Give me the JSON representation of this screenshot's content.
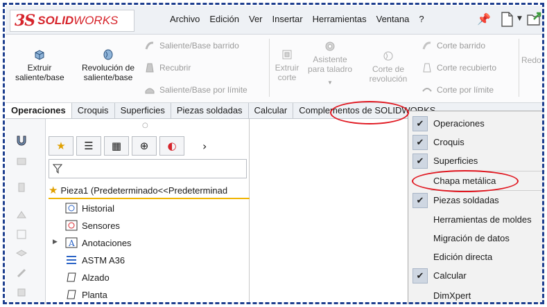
{
  "app": {
    "logo_prefix": "3S",
    "logo_text_bold": "SOLID",
    "logo_text_rest": "WORKS"
  },
  "menu": [
    "Archivo",
    "Edición",
    "Ver",
    "Insertar",
    "Herramientas",
    "Ventana",
    "?"
  ],
  "ribbon": {
    "extruir": "Extruir saliente/base",
    "revolucion": "Revolución de saliente/base",
    "saliente_barrido": "Saliente/Base barrido",
    "recubrir": "Recubrir",
    "saliente_limite": "Saliente/Base por límite",
    "extruir_corte": "Extruir corte",
    "asistente": "Asistente para taladro",
    "corte_revolucion": "Corte de revolución",
    "corte_barrido": "Corte barrido",
    "corte_recubierto": "Corte recubierto",
    "corte_limite": "Corte por límite",
    "redondeo": "Redo"
  },
  "tabs": [
    "Operaciones",
    "Croquis",
    "Superficies",
    "Piezas soldadas",
    "Calcular",
    "Complementos de SOLIDWORKS"
  ],
  "feature_tree": {
    "part": "Pieza1  (Predeterminado<<Predeterminad",
    "items": [
      "Historial",
      "Sensores",
      "Anotaciones",
      "ASTM A36",
      "Alzado",
      "Planta"
    ]
  },
  "context_menu": {
    "items": [
      {
        "label": "Operaciones",
        "checked": true
      },
      {
        "label": "Croquis",
        "checked": true
      },
      {
        "label": "Superficies",
        "checked": true
      },
      {
        "label": "Chapa metálica",
        "checked": false
      },
      {
        "label": "Piezas soldadas",
        "checked": true
      },
      {
        "label": "Herramientas de moldes",
        "checked": false
      },
      {
        "label": "Migración de datos",
        "checked": false
      },
      {
        "label": "Edición directa",
        "checked": false
      },
      {
        "label": "Calcular",
        "checked": true
      },
      {
        "label": "DimXpert",
        "checked": false
      }
    ]
  },
  "colors": {
    "accent_red": "#e0161f",
    "border_blue": "#1e3f8f",
    "brand_red": "#d6242b"
  }
}
